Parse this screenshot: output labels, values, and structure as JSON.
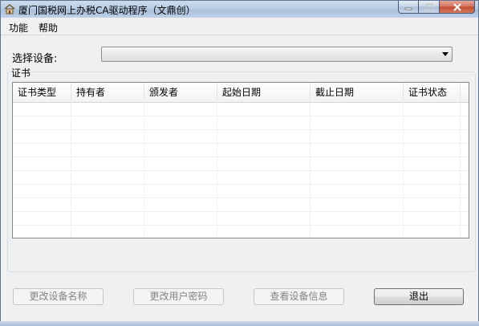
{
  "window": {
    "title": "厦门国税网上办税CA驱动程序（文鼎创）"
  },
  "menu": {
    "items": [
      {
        "label": "功能"
      },
      {
        "label": "帮助"
      }
    ]
  },
  "device_select": {
    "label": "选择设备:",
    "value": ""
  },
  "cert_group": {
    "title": "证书"
  },
  "table": {
    "columns": [
      "证书类型",
      "持有者",
      "颁发者",
      "起始日期",
      "截止日期",
      "证书状态"
    ],
    "rows": []
  },
  "buttons": {
    "rename": "更改设备名称",
    "change_pin": "更改用户密码",
    "device_info": "查看设备信息",
    "exit": "退出"
  }
}
